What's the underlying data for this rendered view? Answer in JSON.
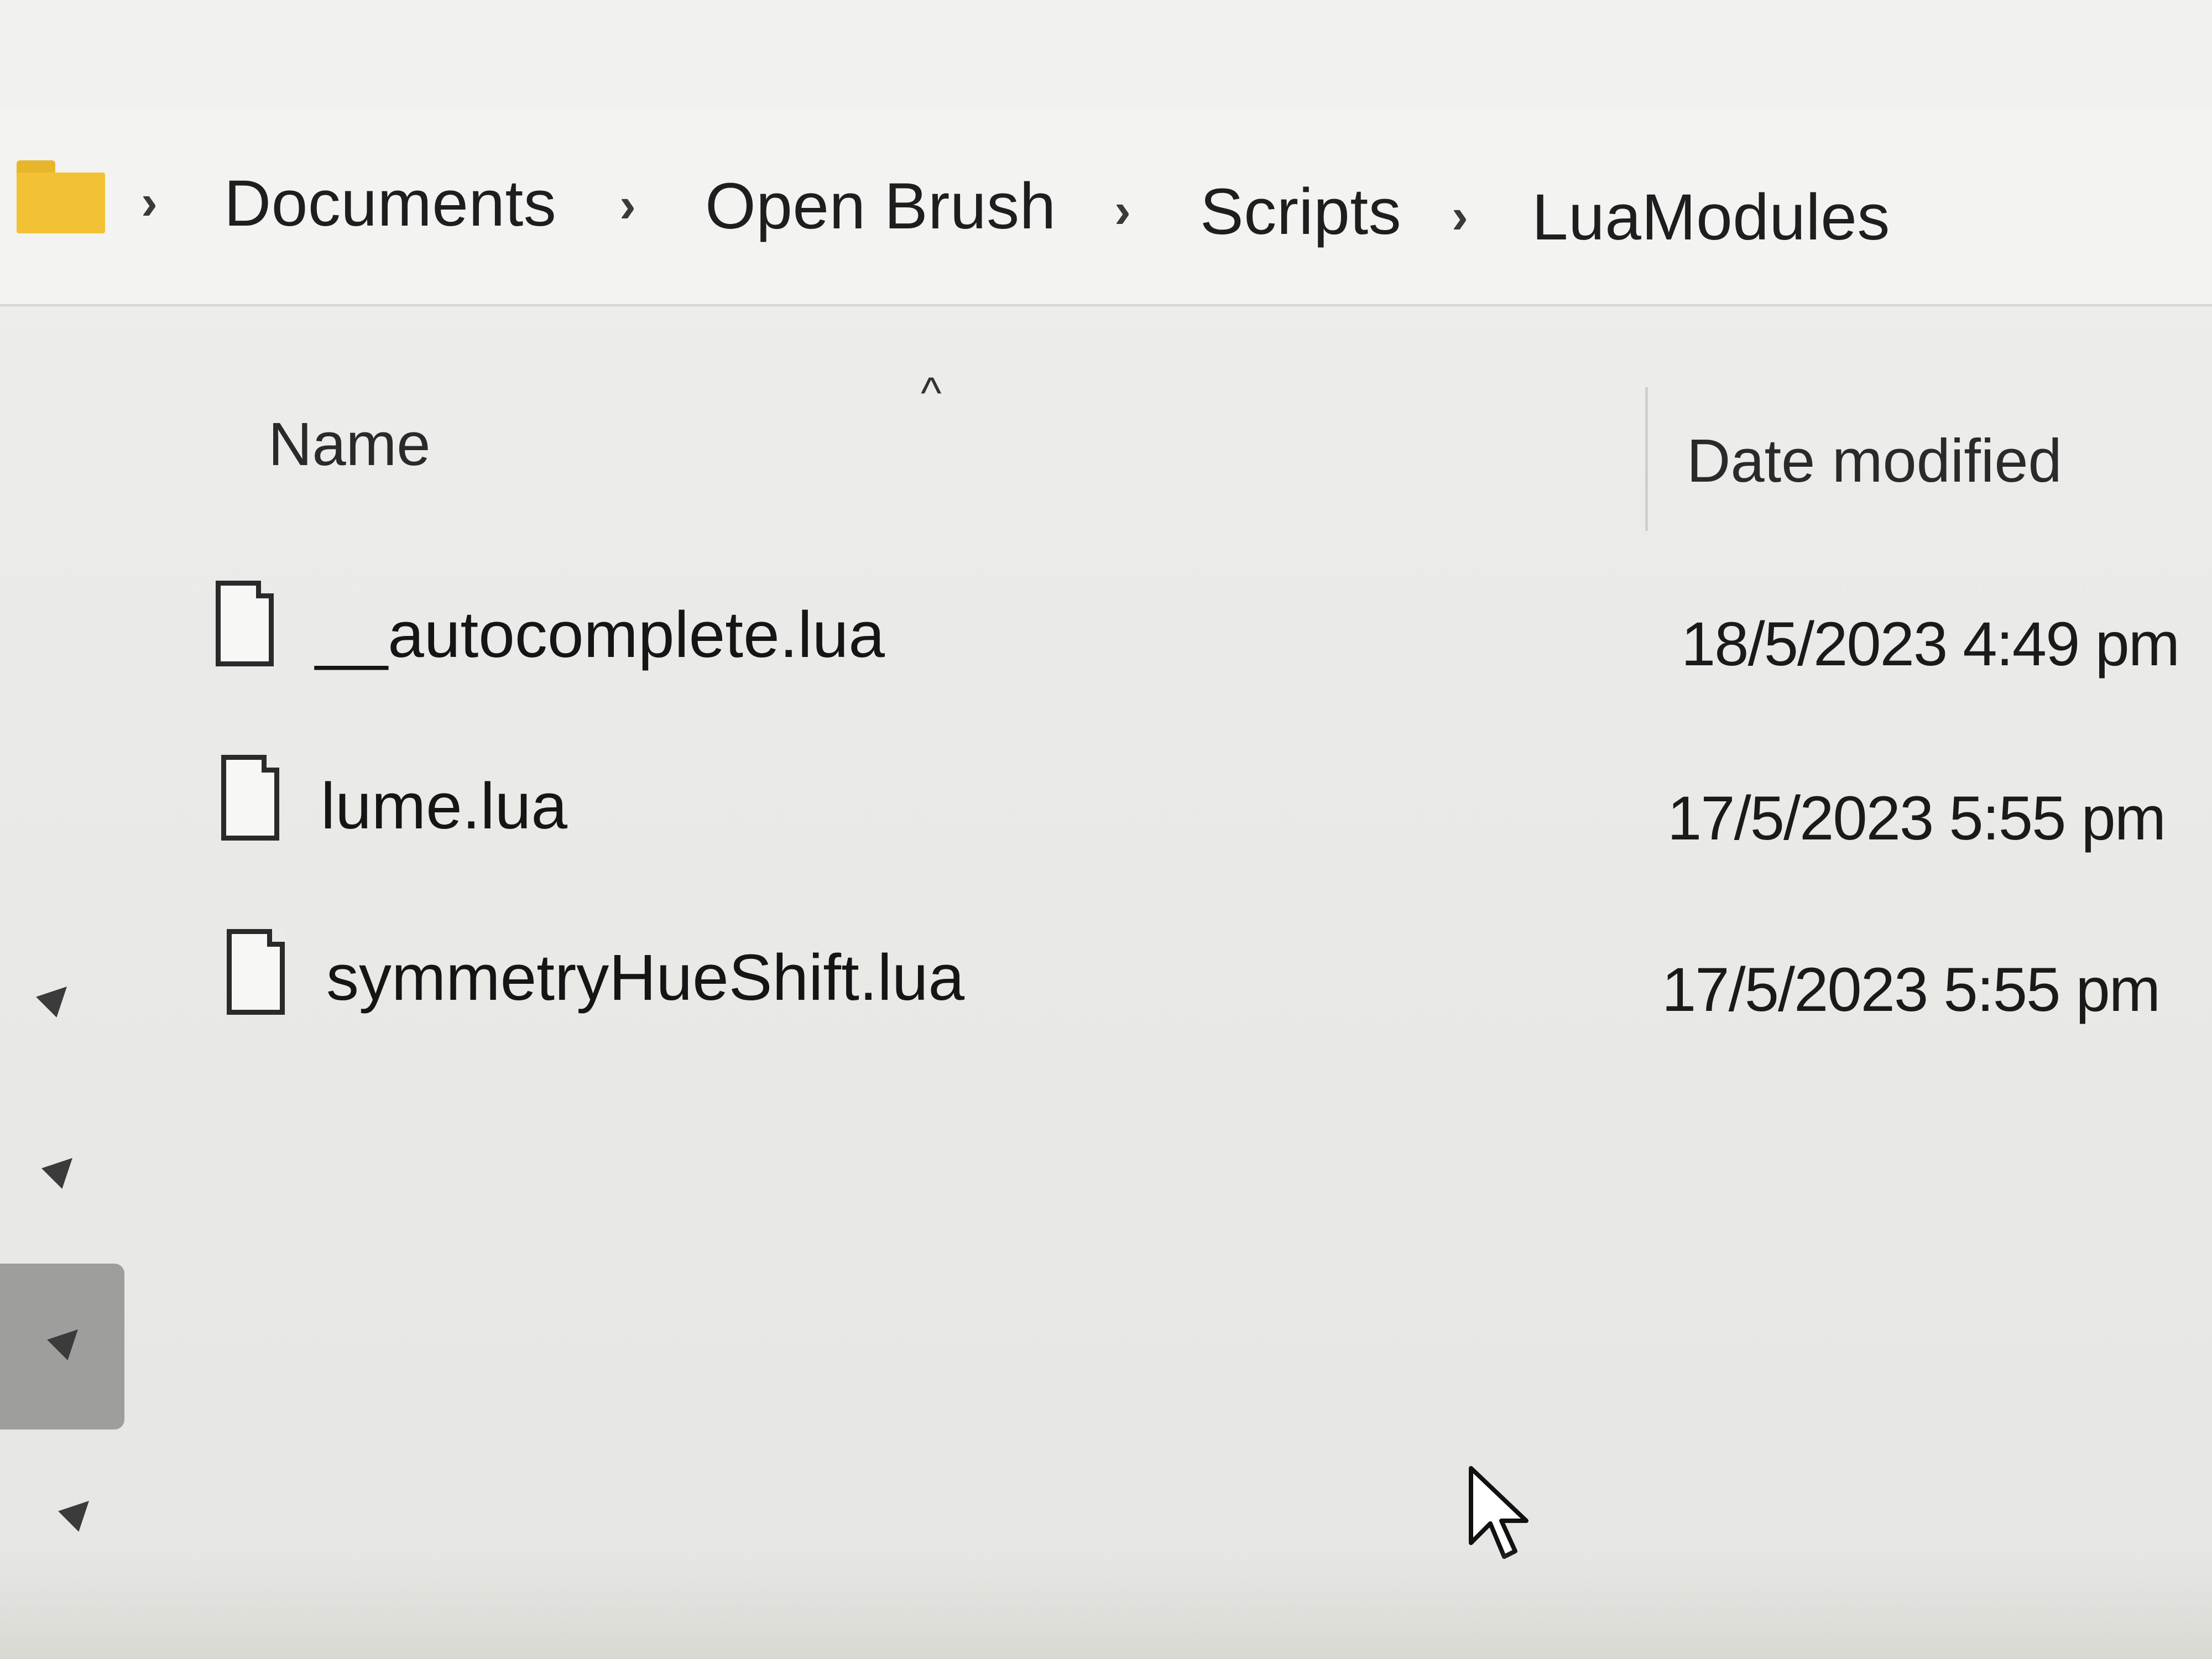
{
  "breadcrumb": {
    "root_icon": "folder-icon",
    "separator_icon": "chevron-right-icon",
    "items": [
      "Documents",
      "Open Brush",
      "Scripts",
      "LuaModules"
    ]
  },
  "columns": {
    "name": "Name",
    "date_modified": "Date modified",
    "sort_icon": "sort-ascending-icon"
  },
  "files": [
    {
      "icon": "file-icon",
      "name": "__autocomplete.lua",
      "date": "18/5/2023 4:49 pm"
    },
    {
      "icon": "file-icon",
      "name": "lume.lua",
      "date": "17/5/2023 5:55 pm"
    },
    {
      "icon": "file-icon",
      "name": "symmetryHueShift.lua",
      "date": "17/5/2023 5:55 pm"
    }
  ],
  "nav_pane": {
    "pins": [
      "pin-icon",
      "pin-icon",
      "pin-icon",
      "pin-icon"
    ]
  },
  "colors": {
    "folder": "#f2c234",
    "background": "#ebebe9",
    "selected_nav": "#9e9e9c"
  }
}
